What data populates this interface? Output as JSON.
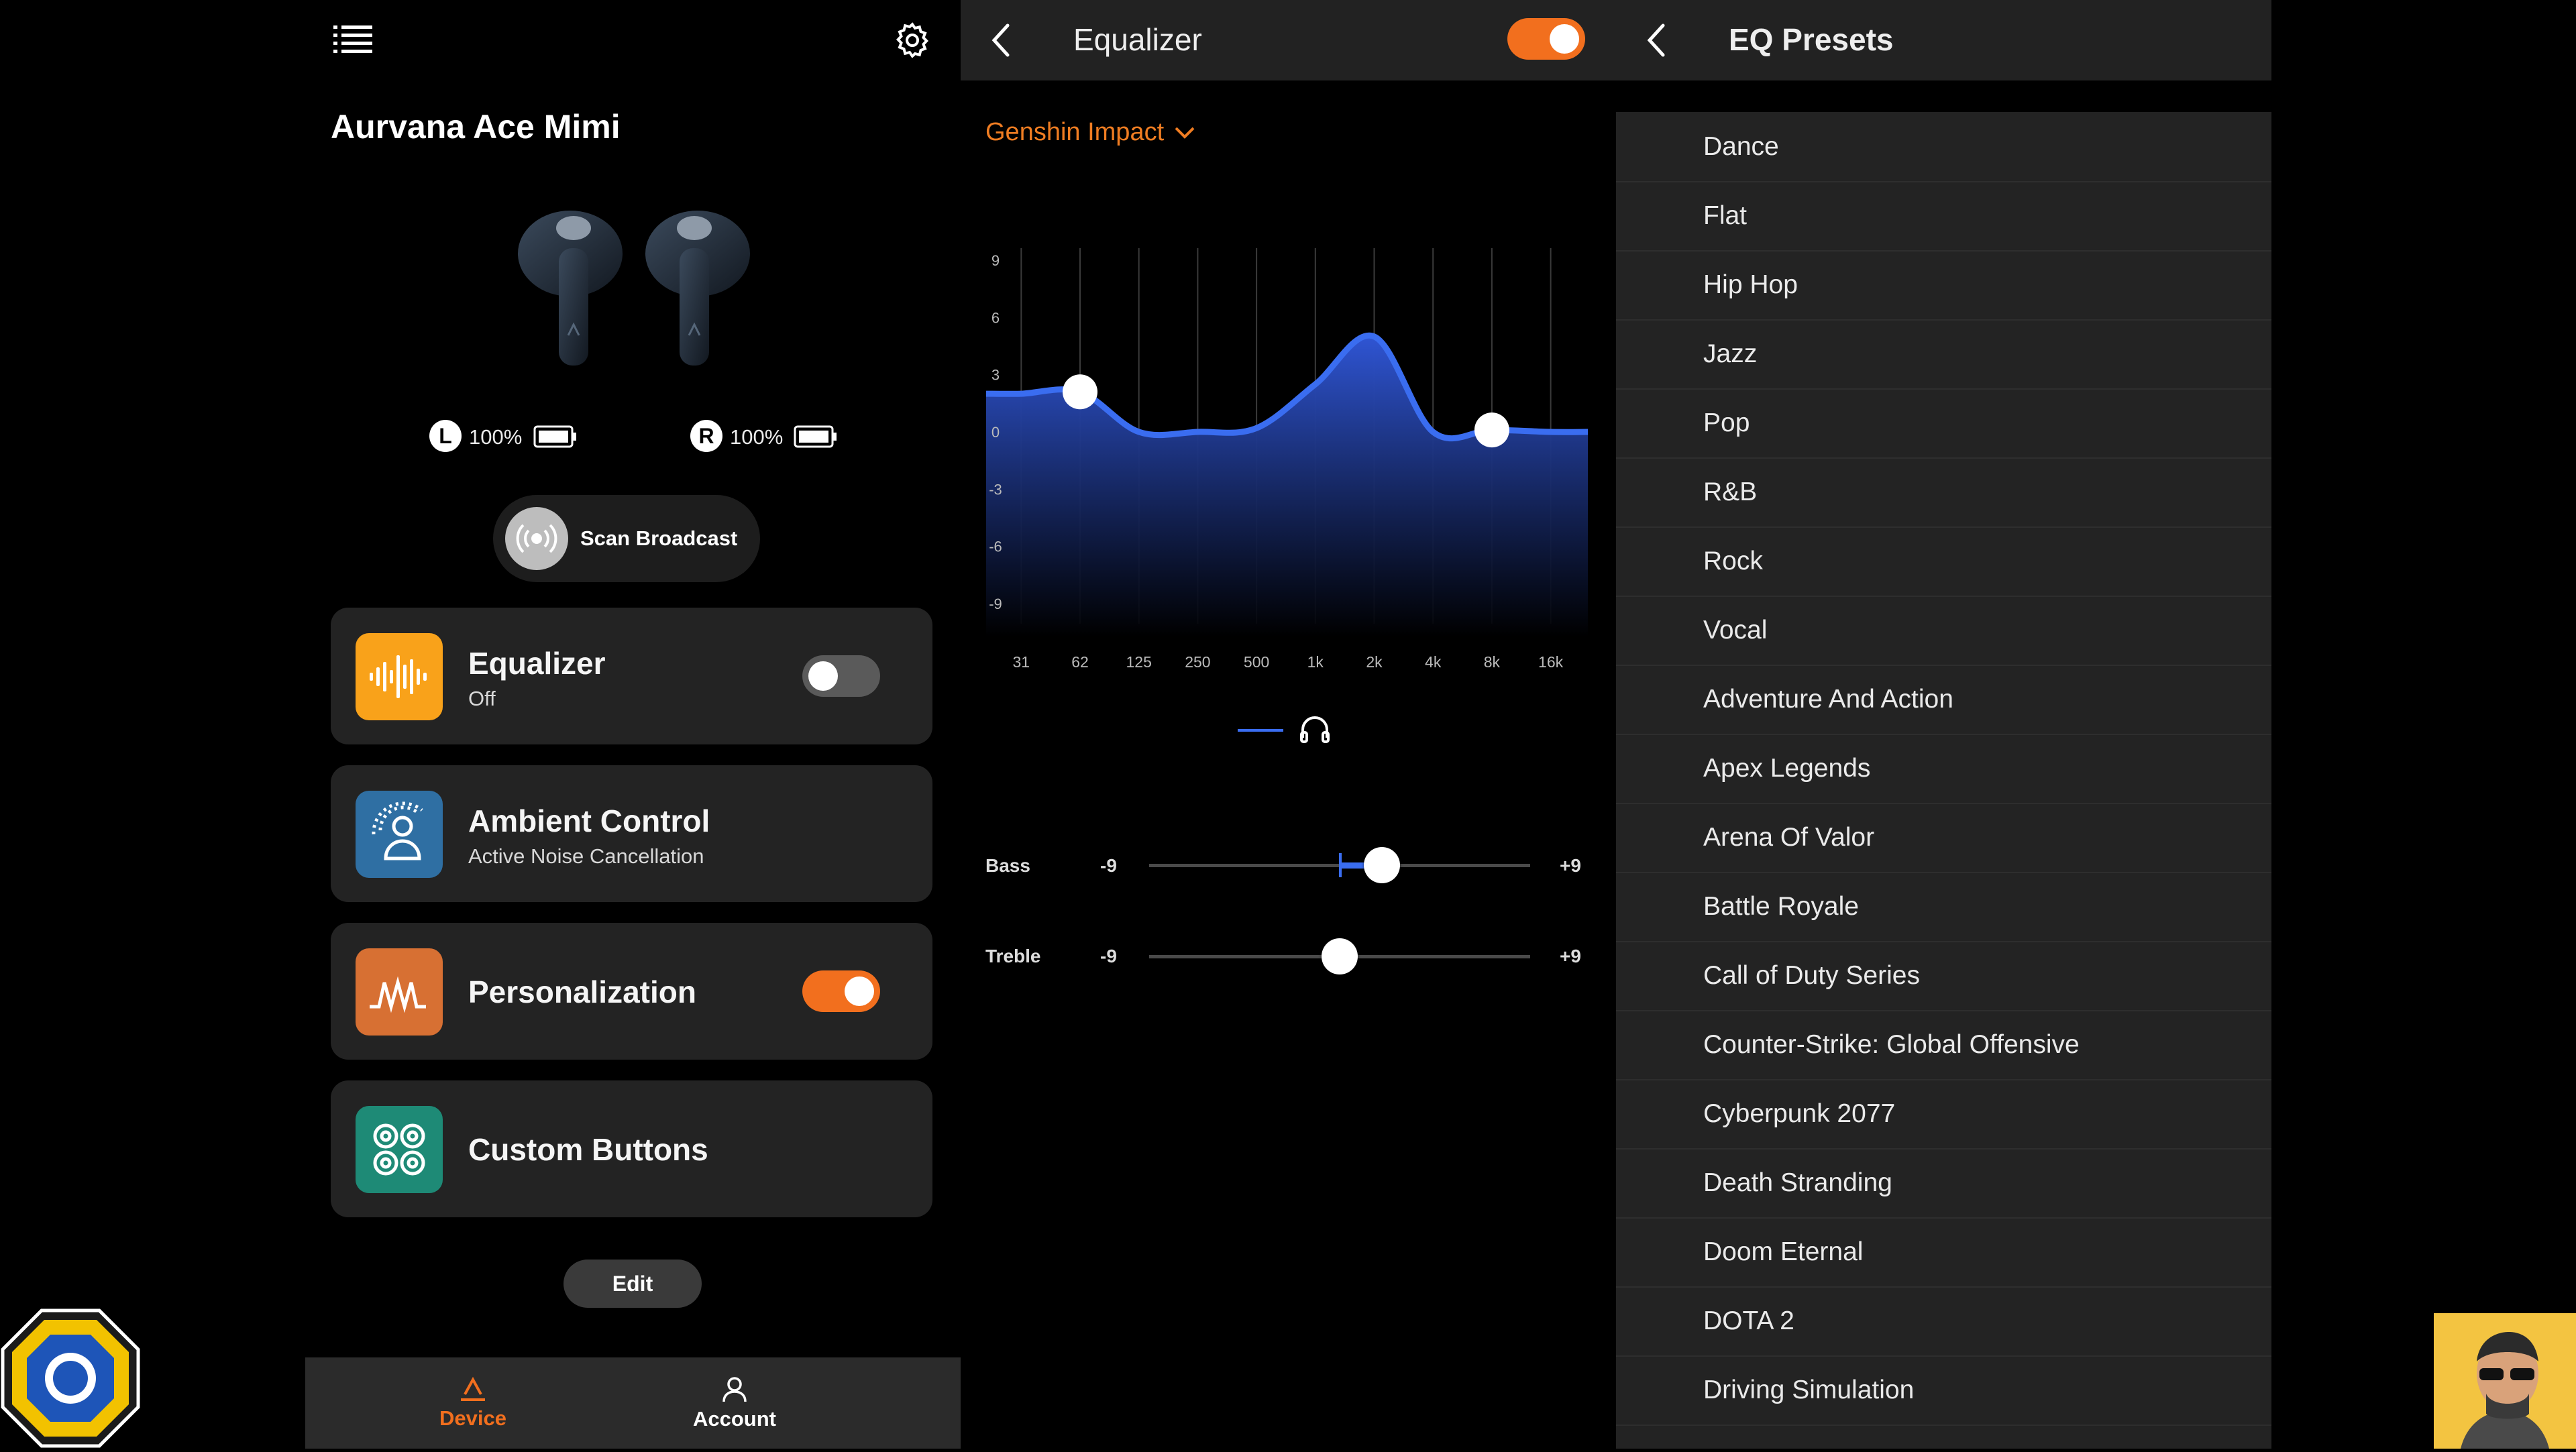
{
  "device": {
    "name": "Aurvana Ace Mimi",
    "left": {
      "badge": "L",
      "battery": "100%"
    },
    "right": {
      "badge": "R",
      "battery": "100%"
    },
    "scan_label": "Scan Broadcast",
    "cards": [
      {
        "title": "Equalizer",
        "subtitle": "Off",
        "toggle": "off",
        "color": "#f9a21a"
      },
      {
        "title": "Ambient Control",
        "subtitle": "Active Noise Cancellation",
        "color": "#2f6fa3"
      },
      {
        "title": "Personalization",
        "subtitle": "",
        "toggle": "on",
        "color": "#d77033"
      },
      {
        "title": "Custom Buttons",
        "subtitle": "",
        "color": "#1e8a76"
      }
    ],
    "edit_label": "Edit",
    "nav": {
      "device": "Device",
      "account": "Account",
      "active": "Device"
    }
  },
  "equalizer": {
    "title": "Equalizer",
    "enabled": true,
    "preset": "Genshin Impact",
    "chart_data": {
      "type": "area",
      "x": [
        "31",
        "62",
        "125",
        "250",
        "500",
        "1k",
        "2k",
        "4k",
        "8k",
        "16k"
      ],
      "y_ticks": [
        "9",
        "6",
        "3",
        "0",
        "-3",
        "-6",
        "-9"
      ],
      "ylim": [
        -9,
        9
      ],
      "values": [
        2.0,
        2.1,
        0.0,
        0.0,
        0.2,
        2.5,
        5.0,
        0.0,
        0.1,
        0.0
      ]
    },
    "bass": {
      "label": "Bass",
      "min": "-9",
      "max": "+9",
      "value": 2
    },
    "treble": {
      "label": "Treble",
      "min": "-9",
      "max": "+9",
      "value": 0
    }
  },
  "presets": {
    "title": "EQ Presets",
    "items": [
      "Dance",
      "Flat",
      "Hip Hop",
      "Jazz",
      "Pop",
      "R&B",
      "Rock",
      "Vocal",
      "Adventure And Action",
      "Apex Legends",
      "Arena Of Valor",
      "Battle Royale",
      "Call of Duty Series",
      "Counter-Strike: Global Offensive",
      "Cyberpunk 2077",
      "Death Stranding",
      "Doom Eternal",
      "DOTA 2",
      "Driving Simulation"
    ]
  },
  "colors": {
    "accent": "#f26f1e",
    "eq_blue": "#3a6df0"
  }
}
